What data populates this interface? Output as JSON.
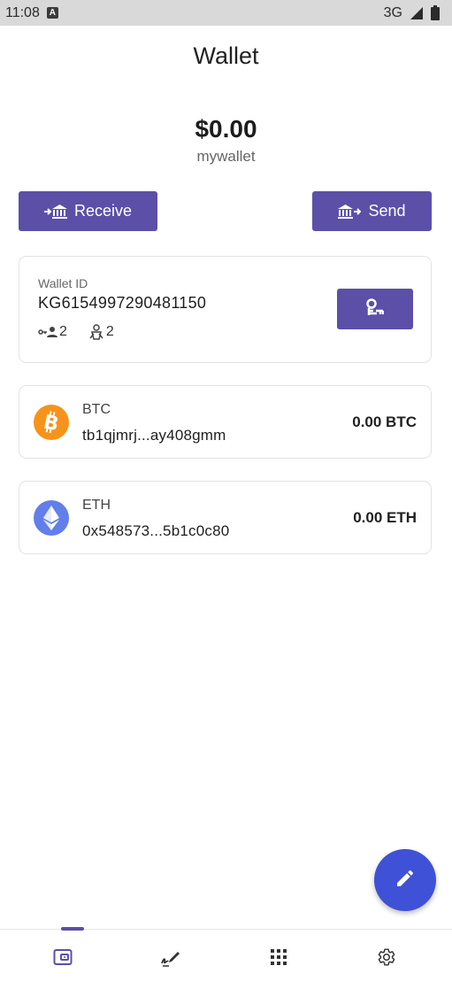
{
  "status_bar": {
    "time": "11:08",
    "app_icon_letter": "A",
    "network": "3G"
  },
  "header": {
    "title": "Wallet"
  },
  "balance": {
    "total": "$0.00",
    "wallet_name": "mywallet"
  },
  "actions": {
    "receive_label": "Receive",
    "send_label": "Send"
  },
  "wallet_card": {
    "id_label": "Wallet ID",
    "id_value": "KG6154997290481150",
    "keys_count": "2",
    "signers_count": "2"
  },
  "coins": [
    {
      "symbol": "BTC",
      "address": "tb1qjmrj...ay408gmm",
      "balance": "0.00 BTC",
      "icon": "bitcoin-icon",
      "color": "#f7931a"
    },
    {
      "symbol": "ETH",
      "address": "0x548573...5b1c0c80",
      "balance": "0.00 ETH",
      "icon": "ethereum-icon",
      "color": "#627eea"
    }
  ],
  "colors": {
    "accent": "#5b4fa8",
    "fab": "#3f51d6"
  },
  "bottom_nav": [
    {
      "icon": "wallet-icon",
      "active": true
    },
    {
      "icon": "signature-icon",
      "active": false
    },
    {
      "icon": "apps-grid-icon",
      "active": false
    },
    {
      "icon": "gear-icon",
      "active": false
    }
  ]
}
